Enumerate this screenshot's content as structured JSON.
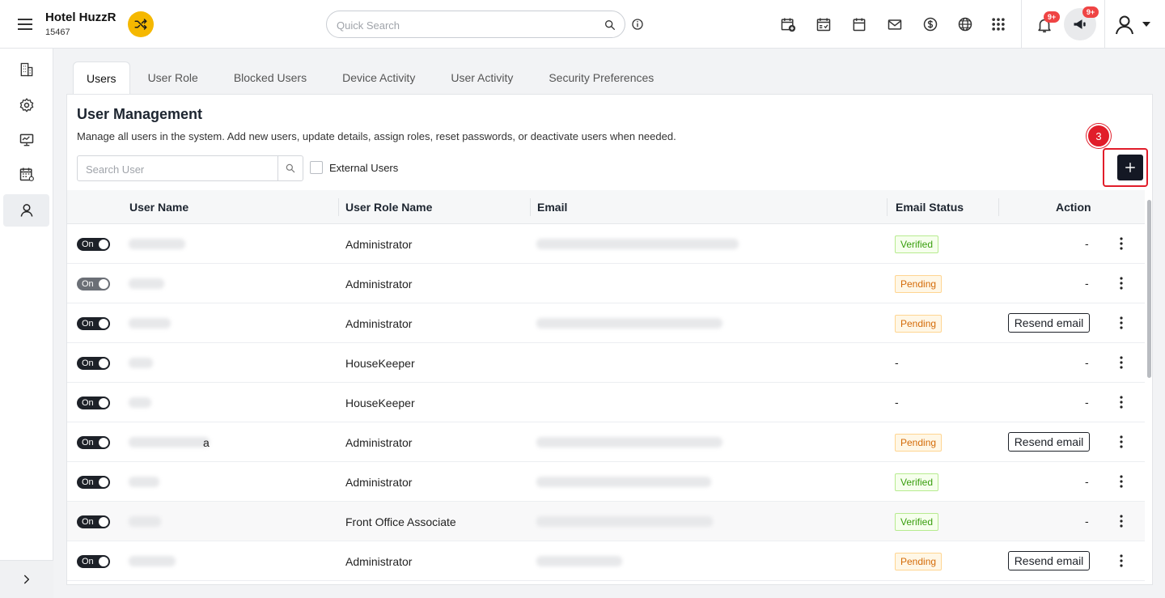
{
  "header": {
    "hotel_name": "Hotel HuzzR",
    "hotel_id": "15467",
    "search_placeholder": "Quick Search",
    "notification_badge": "9+",
    "announcement_badge": "9+",
    "icons": [
      "calendar-plus-icon",
      "calendar-check-icon",
      "calendar-icon",
      "mail-icon",
      "dollar-icon",
      "globe-icon",
      "apps-grid-icon"
    ]
  },
  "sidebar": {
    "items": [
      "building-icon",
      "gear-icon",
      "monitor-icon",
      "calendar-grid-icon",
      "user-icon"
    ],
    "active": "user-icon"
  },
  "tabs": [
    {
      "label": "Users",
      "active": true
    },
    {
      "label": "User Role"
    },
    {
      "label": "Blocked Users"
    },
    {
      "label": "Device Activity"
    },
    {
      "label": "User Activity"
    },
    {
      "label": "Security Preferences"
    }
  ],
  "page": {
    "title": "User Management",
    "description": "Manage all users in the system. Add new users, update details, assign roles, reset passwords, or deactivate users when needed.",
    "search_placeholder": "Search User",
    "external_users_label": "External Users",
    "step_number": "3"
  },
  "table": {
    "columns": [
      "User Name",
      "User Role Name",
      "Email",
      "Email Status",
      "Action"
    ],
    "rows": [
      {
        "toggle": "On",
        "name_tail": "",
        "role": "Administrator",
        "has_email": true,
        "status": "Verified",
        "action": "-"
      },
      {
        "toggle": "On",
        "name_tail": "",
        "role": "Administrator",
        "has_email": false,
        "status": "Pending",
        "action": "-"
      },
      {
        "toggle": "On",
        "name_tail": "",
        "role": "Administrator",
        "has_email": true,
        "status": "Pending",
        "action": "Resend email"
      },
      {
        "toggle": "On",
        "name_tail": "",
        "role": "HouseKeeper",
        "has_email": false,
        "status": "-",
        "action": "-"
      },
      {
        "toggle": "On",
        "name_tail": "",
        "role": "HouseKeeper",
        "has_email": false,
        "status": "-",
        "action": "-"
      },
      {
        "toggle": "On",
        "name_tail": "a",
        "role": "Administrator",
        "has_email": true,
        "status": "Pending",
        "action": "Resend email"
      },
      {
        "toggle": "On",
        "name_tail": "",
        "role": "Administrator",
        "has_email": true,
        "status": "Verified",
        "action": "-"
      },
      {
        "toggle": "On",
        "name_tail": "",
        "role": "Front Office Associate",
        "has_email": true,
        "status": "Verified",
        "action": "-"
      },
      {
        "toggle": "On",
        "name_tail": "",
        "role": "Administrator",
        "has_email": true,
        "status": "Pending",
        "action": "Resend email"
      }
    ]
  },
  "colors": {
    "accent_yellow": "#f5b800",
    "add_button": "#141824",
    "highlight_red": "#e11d2a",
    "verified_green": "#389e0d",
    "pending_orange": "#d46b08"
  }
}
